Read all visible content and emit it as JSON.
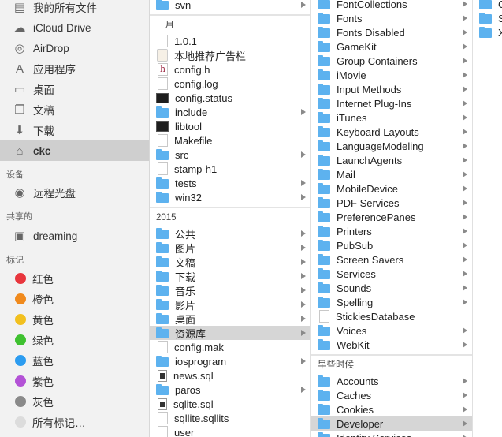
{
  "sidebar": {
    "favorites": [
      {
        "label": "我的所有文件",
        "icon": "all-files-icon"
      },
      {
        "label": "iCloud Drive",
        "icon": "cloud-icon"
      },
      {
        "label": "AirDrop",
        "icon": "airdrop-icon"
      },
      {
        "label": "应用程序",
        "icon": "applications-icon"
      },
      {
        "label": "桌面",
        "icon": "desktop-icon"
      },
      {
        "label": "文稿",
        "icon": "documents-icon"
      },
      {
        "label": "下载",
        "icon": "download-icon"
      },
      {
        "label": "ckc",
        "icon": "home-icon",
        "selected": true
      }
    ],
    "devices_header": "设备",
    "devices": [
      {
        "label": "远程光盘",
        "icon": "disc-icon"
      }
    ],
    "shared_header": "共享的",
    "shared": [
      {
        "label": "dreaming",
        "icon": "computer-icon"
      }
    ],
    "tags_header": "标记",
    "tags": [
      {
        "label": "红色",
        "color": "#e8363d"
      },
      {
        "label": "橙色",
        "color": "#f08a1d"
      },
      {
        "label": "黄色",
        "color": "#f2c01f"
      },
      {
        "label": "绿色",
        "color": "#3fc130"
      },
      {
        "label": "蓝色",
        "color": "#2c9cf0"
      },
      {
        "label": "紫色",
        "color": "#b352d6"
      },
      {
        "label": "灰色",
        "color": "#8a8a8a"
      },
      {
        "label": "所有标记…",
        "color": "#dcdcdc"
      }
    ]
  },
  "columns": [
    {
      "entries": [
        {
          "label": "svn",
          "icon": "folder",
          "arrow": true
        },
        {
          "divider": true
        },
        {
          "header": "一月"
        },
        {
          "label": "1.0.1",
          "icon": "doc"
        },
        {
          "label": "本地推荐广告栏",
          "icon": "app"
        },
        {
          "label": "config.h",
          "icon": "h"
        },
        {
          "label": "config.log",
          "icon": "doc"
        },
        {
          "label": "config.status",
          "icon": "exec"
        },
        {
          "label": "include",
          "icon": "folder",
          "arrow": true
        },
        {
          "label": "libtool",
          "icon": "exec"
        },
        {
          "label": "Makefile",
          "icon": "doc"
        },
        {
          "label": "src",
          "icon": "folder",
          "arrow": true
        },
        {
          "label": "stamp-h1",
          "icon": "doc"
        },
        {
          "label": "tests",
          "icon": "folder",
          "arrow": true
        },
        {
          "label": "win32",
          "icon": "folder",
          "arrow": true
        },
        {
          "divider": true
        },
        {
          "header": "2015"
        },
        {
          "label": "公共",
          "icon": "folder",
          "arrow": true
        },
        {
          "label": "图片",
          "icon": "folder",
          "arrow": true
        },
        {
          "label": "文稿",
          "icon": "folder",
          "arrow": true
        },
        {
          "label": "下载",
          "icon": "folder",
          "arrow": true
        },
        {
          "label": "音乐",
          "icon": "folder",
          "arrow": true
        },
        {
          "label": "影片",
          "icon": "folder",
          "arrow": true
        },
        {
          "label": "桌面",
          "icon": "folder",
          "arrow": true
        },
        {
          "label": "资源库",
          "icon": "folder",
          "arrow": true,
          "selected": true
        },
        {
          "label": "config.mak",
          "icon": "doc"
        },
        {
          "label": "iosprogram",
          "icon": "folder",
          "arrow": true
        },
        {
          "label": "news.sql",
          "icon": "sql"
        },
        {
          "label": "paros",
          "icon": "folder",
          "arrow": true
        },
        {
          "label": "sqlite.sql",
          "icon": "sql"
        },
        {
          "label": "sqllite.sqllits",
          "icon": "doc"
        },
        {
          "label": "user",
          "icon": "doc"
        }
      ]
    },
    {
      "entries": [
        {
          "label": "FontCollections",
          "icon": "folder",
          "arrow": true
        },
        {
          "label": "Fonts",
          "icon": "folder",
          "arrow": true
        },
        {
          "label": "Fonts Disabled",
          "icon": "folder",
          "arrow": true
        },
        {
          "label": "GameKit",
          "icon": "folder",
          "arrow": true
        },
        {
          "label": "Group Containers",
          "icon": "folder",
          "arrow": true
        },
        {
          "label": "iMovie",
          "icon": "folder",
          "arrow": true
        },
        {
          "label": "Input Methods",
          "icon": "folder",
          "arrow": true
        },
        {
          "label": "Internet Plug-Ins",
          "icon": "folder",
          "arrow": true
        },
        {
          "label": "iTunes",
          "icon": "folder",
          "arrow": true
        },
        {
          "label": "Keyboard Layouts",
          "icon": "folder",
          "arrow": true
        },
        {
          "label": "LanguageModeling",
          "icon": "folder",
          "arrow": true
        },
        {
          "label": "LaunchAgents",
          "icon": "folder",
          "arrow": true
        },
        {
          "label": "Mail",
          "icon": "folder",
          "arrow": true
        },
        {
          "label": "MobileDevice",
          "icon": "folder",
          "arrow": true
        },
        {
          "label": "PDF Services",
          "icon": "folder",
          "arrow": true
        },
        {
          "label": "PreferencePanes",
          "icon": "folder",
          "arrow": true
        },
        {
          "label": "Printers",
          "icon": "folder",
          "arrow": true
        },
        {
          "label": "PubSub",
          "icon": "folder",
          "arrow": true
        },
        {
          "label": "Screen Savers",
          "icon": "folder",
          "arrow": true
        },
        {
          "label": "Services",
          "icon": "folder",
          "arrow": true
        },
        {
          "label": "Sounds",
          "icon": "folder",
          "arrow": true
        },
        {
          "label": "Spelling",
          "icon": "folder",
          "arrow": true
        },
        {
          "label": "StickiesDatabase",
          "icon": "doc"
        },
        {
          "label": "Voices",
          "icon": "folder",
          "arrow": true
        },
        {
          "label": "WebKit",
          "icon": "folder",
          "arrow": true
        },
        {
          "divider": true
        },
        {
          "header": "早些时候"
        },
        {
          "label": "Accounts",
          "icon": "folder",
          "arrow": true
        },
        {
          "label": "Caches",
          "icon": "folder",
          "arrow": true
        },
        {
          "label": "Cookies",
          "icon": "folder",
          "arrow": true
        },
        {
          "label": "Developer",
          "icon": "folder",
          "arrow": true,
          "selected": true
        },
        {
          "label": "Identity Services",
          "icon": "folder",
          "arrow": true
        }
      ]
    },
    {
      "entries": [
        {
          "label": "C",
          "icon": "folder"
        },
        {
          "label": "S",
          "icon": "folder"
        },
        {
          "label": "X",
          "icon": "folder"
        }
      ]
    }
  ]
}
